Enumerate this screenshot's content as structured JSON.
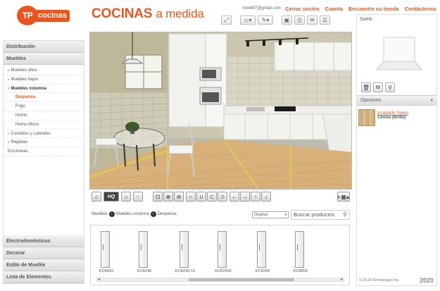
{
  "header": {
    "logo_tp": "TP",
    "logo_word": "cocinas",
    "title_main": "COCINAS",
    "title_rest": "a medida",
    "user_email": "molet87@gmail.com",
    "links": [
      "Cerrar sesión",
      "Cuenta",
      "Encuentre su tienda",
      "Contáctenos"
    ]
  },
  "sidebar": {
    "sections_top": [
      "Distribución",
      "Muebles"
    ],
    "items": [
      {
        "label": "Muebles altos",
        "level": 1
      },
      {
        "label": "Muebles bajos",
        "level": 1
      },
      {
        "label": "Muebles columna",
        "level": 1,
        "open": true
      },
      {
        "label": "Despensa",
        "level": 2,
        "active": true
      },
      {
        "label": "Frigo",
        "level": 2
      },
      {
        "label": "Horno",
        "level": 2
      },
      {
        "label": "Horno-Micro",
        "level": 2
      },
      {
        "label": "Costados y Laterales",
        "level": 1
      },
      {
        "label": "Regletas",
        "level": 1
      },
      {
        "label": "Encimeras",
        "level": 1
      }
    ],
    "sections_bottom": [
      "Electrodomésticos",
      "Decorar",
      "Estilo de Mueble",
      "Lista de Elementos"
    ]
  },
  "viewer_controls": {
    "hq_label": "HQ"
  },
  "breadcrumb": {
    "items": [
      "Muebles",
      "Muebles columna",
      "Despensa"
    ],
    "sort_value": "Original",
    "search_placeholder": "Buscar productos"
  },
  "catalog": [
    {
      "code": "KCB602"
    },
    {
      "code": "KCB240"
    },
    {
      "code": "KCB240-15"
    },
    {
      "code": "KCB2402"
    },
    {
      "code": "KCB260"
    },
    {
      "code": "KCB602"
    }
  ],
  "right_panel": {
    "title": "Suelo",
    "options_label": "Opciones",
    "option_name": "Acabado Suelo",
    "option_value": "Ceniza (Brillo)",
    "footer": "© 20-20 Technologies Inc.",
    "footer_mark": "2020"
  },
  "colors": {
    "brand": "#e8551f",
    "floor": "#d7b07a",
    "wall": "#cfcab6"
  }
}
